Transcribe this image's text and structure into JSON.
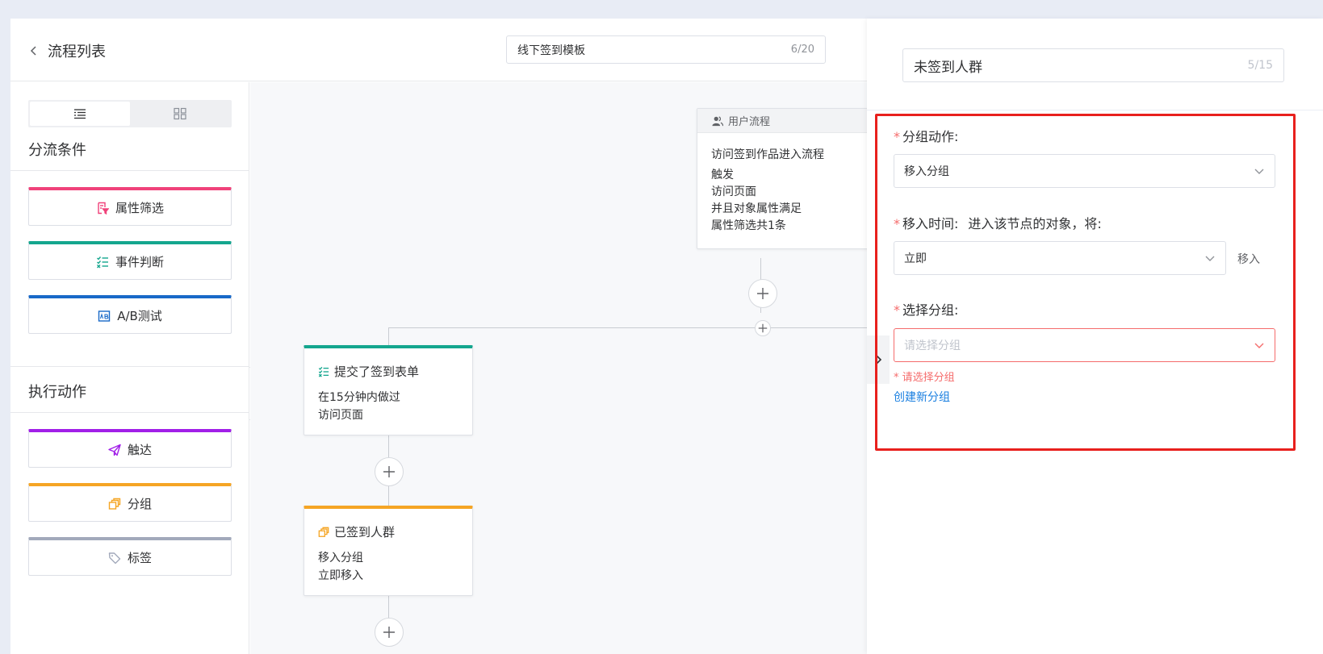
{
  "header": {
    "back_label": "流程列表",
    "flow_name": "线下签到模板",
    "flow_name_count": "6/20"
  },
  "sidebar": {
    "branch_title": "分流条件",
    "branch_items": [
      {
        "label": "属性筛选",
        "color": "#f0427a",
        "icon": "filter-doc-icon"
      },
      {
        "label": "事件判断",
        "color": "#14a68e",
        "icon": "checklist-icon"
      },
      {
        "label": "A/B测试",
        "color": "#1869c8",
        "icon": "ab-chart-icon"
      }
    ],
    "action_title": "执行动作",
    "action_items": [
      {
        "label": "触达",
        "color": "#a11fe8",
        "icon": "paper-plane-icon"
      },
      {
        "label": "分组",
        "color": "#f5a524",
        "icon": "group-copy-icon"
      },
      {
        "label": "标签",
        "color": "#a2a9bb",
        "icon": "tag-icon"
      }
    ]
  },
  "canvas": {
    "user_flow": {
      "header": "用户流程",
      "title": "访问签到作品进入流程",
      "lines": [
        "触发",
        "访问页面",
        "并且对象属性满足",
        "属性筛选共1条"
      ]
    },
    "event_node": {
      "title": "提交了签到表单",
      "lines": [
        "在15分钟内做过",
        "访问页面"
      ],
      "color": "#14a68e"
    },
    "group_node": {
      "title": "已签到人群",
      "lines": [
        "移入分组",
        "立即移入"
      ],
      "color": "#f5a524"
    }
  },
  "panel": {
    "node_name": "未签到人群",
    "node_name_count": "5/15",
    "group_action_label": "分组动作:",
    "group_action_value": "移入分组",
    "move_time_label": "移入时间:",
    "move_time_hint": "进入该节点的对象，将:",
    "move_time_value": "立即",
    "move_time_suffix": "移入",
    "select_group_label": "选择分组:",
    "select_group_placeholder": "请选择分组",
    "select_group_error": "请选择分组",
    "create_group_link": "创建新分组",
    "highlight_color": "#e8201d"
  }
}
